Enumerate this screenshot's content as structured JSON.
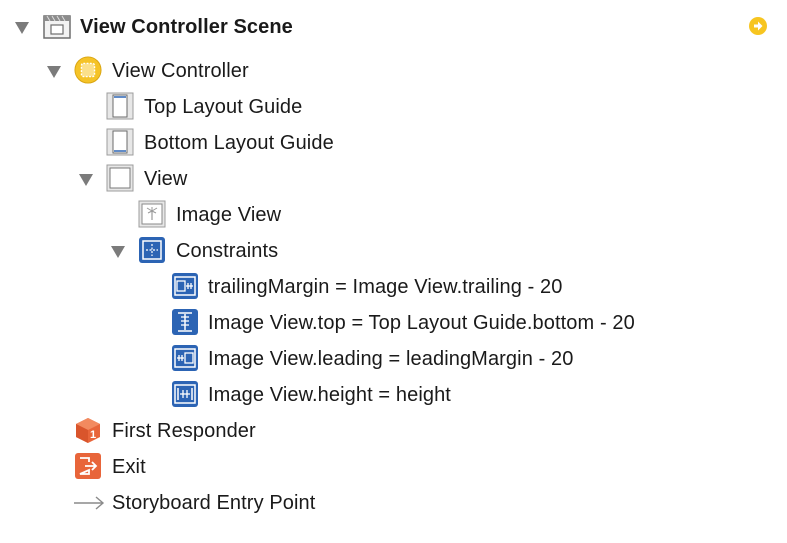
{
  "outline": {
    "scene": {
      "label": "View Controller Scene",
      "icon": "scene-icon",
      "right_icon": "navigate-arrow-icon"
    },
    "view_controller": {
      "label": "View Controller",
      "icon": "view-controller-icon"
    },
    "top_layout_guide": {
      "label": "Top Layout Guide",
      "icon": "layout-guide-top-icon"
    },
    "bottom_layout_guide": {
      "label": "Bottom Layout Guide",
      "icon": "layout-guide-bottom-icon"
    },
    "view": {
      "label": "View",
      "icon": "view-icon"
    },
    "image_view": {
      "label": "Image View",
      "icon": "image-view-icon"
    },
    "constraints": {
      "label": "Constraints",
      "icon": "constraints-icon",
      "items": [
        {
          "label": "trailingMargin = Image View.trailing - 20",
          "icon": "trailing-constraint-icon"
        },
        {
          "label": "Image View.top = Top Layout Guide.bottom - 20",
          "icon": "top-constraint-icon"
        },
        {
          "label": "Image View.leading = leadingMargin - 20",
          "icon": "leading-constraint-icon"
        },
        {
          "label": "Image View.height = height",
          "icon": "height-constraint-icon"
        }
      ]
    },
    "first_responder": {
      "label": "First Responder",
      "icon": "first-responder-icon"
    },
    "exit": {
      "label": "Exit",
      "icon": "exit-icon"
    },
    "entry_point": {
      "label": "Storyboard Entry Point",
      "icon": "entry-point-arrow-icon"
    }
  },
  "colors": {
    "disclosure": "#7b7b7b",
    "vc_yellow": "#f5c327",
    "constraint_blue": "#2c64b4",
    "exit_orange": "#e8653a",
    "accent_yellow": "#f7c520"
  }
}
